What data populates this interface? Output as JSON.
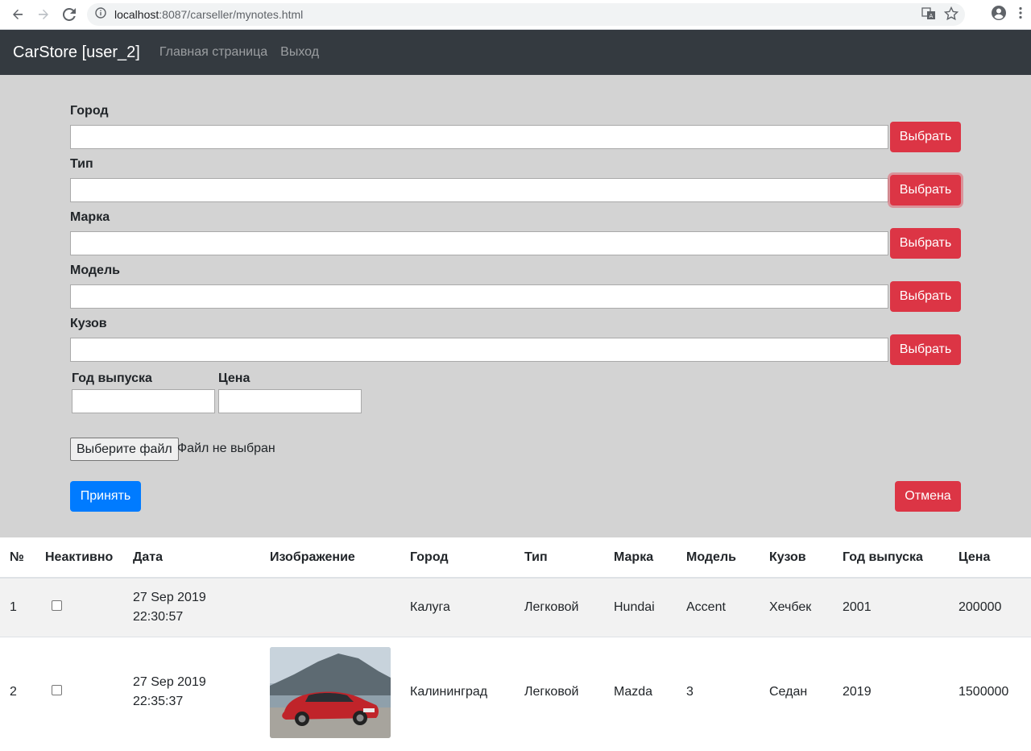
{
  "browser": {
    "url_host": "localhost",
    "url_path": ":8087/carseller/mynotes.html"
  },
  "navbar": {
    "brand": "CarStore [user_2]",
    "links": [
      "Главная страница",
      "Выход"
    ]
  },
  "form": {
    "fields": [
      {
        "label": "Город",
        "value": "",
        "button": "Выбрать"
      },
      {
        "label": "Тип",
        "value": "",
        "button": "Выбрать"
      },
      {
        "label": "Марка",
        "value": "",
        "button": "Выбрать"
      },
      {
        "label": "Модель",
        "value": "",
        "button": "Выбрать"
      },
      {
        "label": "Кузов",
        "value": "",
        "button": "Выбрать"
      }
    ],
    "year_label": "Год выпуска",
    "price_label": "Цена",
    "file_button": "Выберите файл",
    "file_status": "Файл не выбран",
    "submit": "Принять",
    "cancel": "Отмена"
  },
  "table": {
    "headers": [
      "№",
      "Неактивно",
      "Дата",
      "Изображение",
      "Город",
      "Тип",
      "Марка",
      "Модель",
      "Кузов",
      "Год выпуска",
      "Цена"
    ],
    "rows": [
      {
        "num": "1",
        "inactive": false,
        "date": "27 Sep 2019",
        "time": "22:30:57",
        "has_image": false,
        "city": "Калуга",
        "type": "Легковой",
        "brand": "Hundai",
        "model": "Accent",
        "body": "Хечбек",
        "year": "2001",
        "price": "200000"
      },
      {
        "num": "2",
        "inactive": false,
        "date": "27 Sep 2019",
        "time": "22:35:37",
        "has_image": true,
        "city": "Калининград",
        "type": "Легковой",
        "brand": "Mazda",
        "model": "3",
        "body": "Седан",
        "year": "2019",
        "price": "1500000"
      }
    ]
  }
}
